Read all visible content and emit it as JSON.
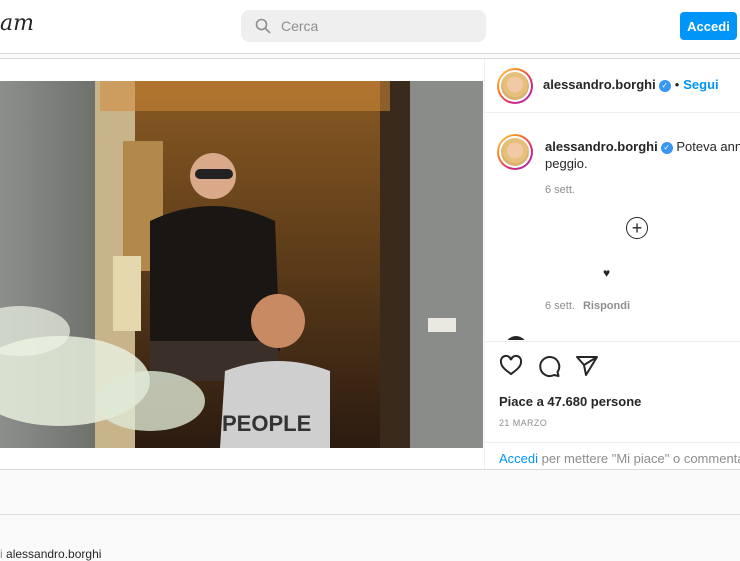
{
  "header": {
    "logo_text": "am",
    "search_placeholder": "Cerca",
    "login_label": "Accedi"
  },
  "post": {
    "username": "alessandro.borghi",
    "follow_label": "Segui",
    "caption_text": "Poteva annà",
    "caption_text2": "peggio.",
    "caption_time": "6 sett.",
    "reply_time": "6 sett.",
    "reply_label": "Rispondi",
    "likes_text": "Piace a 47.680 persone",
    "date_text": "21 MARZO",
    "login_link": "Accedi",
    "login_rest": "per mettere \"Mi piace\" o commentare",
    "more_from_prefix": "i",
    "more_from_user": "alessandro.borghi"
  },
  "icons": [
    "search-icon",
    "verified-icon",
    "add-icon",
    "heart-icon",
    "comment-icon",
    "share-icon"
  ],
  "colors": {
    "accent": "#0095f6",
    "verified": "#3897f0",
    "border": "#dbdbdb"
  },
  "photo": {
    "shirt_text": "PEOPLE"
  }
}
